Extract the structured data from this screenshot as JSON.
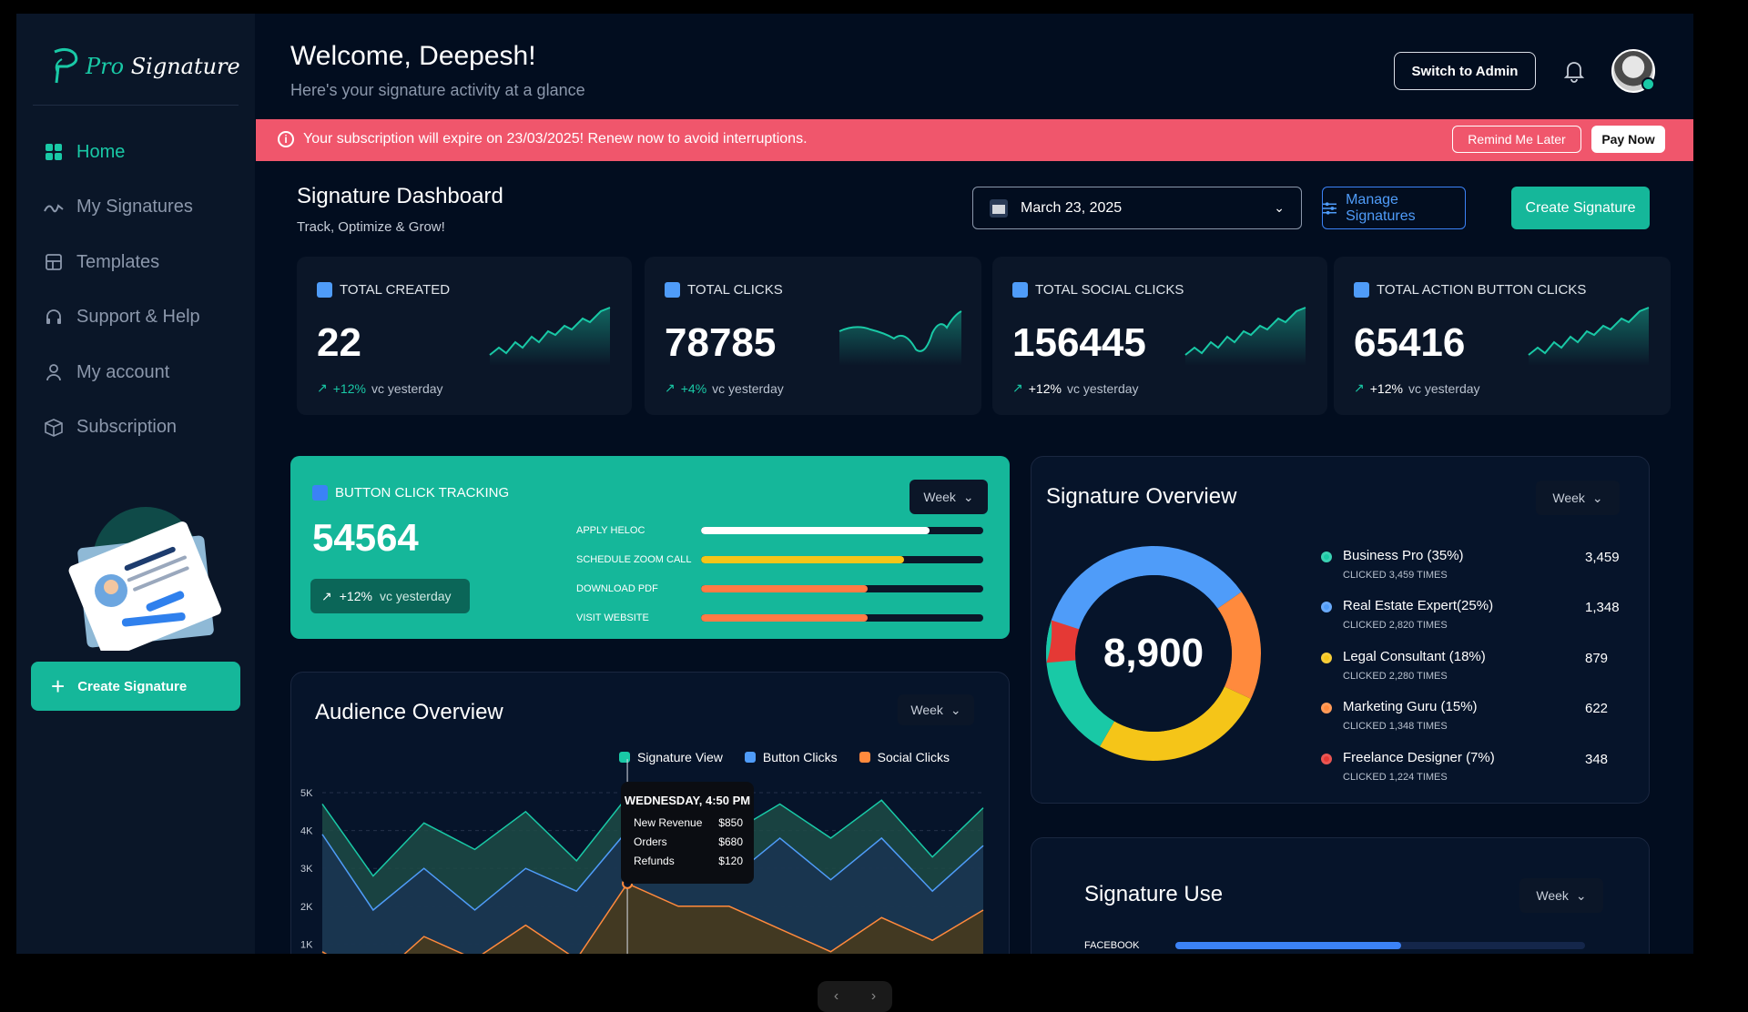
{
  "brand": {
    "logo_pro": "Pro",
    "logo_rest": "Signature"
  },
  "sidebar": {
    "items": [
      {
        "label": "Home",
        "icon": "grid-icon"
      },
      {
        "label": "My Signatures",
        "icon": "signature-icon"
      },
      {
        "label": "Templates",
        "icon": "templates-icon"
      },
      {
        "label": "Support & Help",
        "icon": "headset-icon"
      },
      {
        "label": "My account",
        "icon": "user-icon"
      },
      {
        "label": "Subscription",
        "icon": "box-icon"
      }
    ],
    "create_label": "Create Signature"
  },
  "header": {
    "title": "Welcome, Deepesh!",
    "subtitle": "Here's your signature activity at a glance",
    "admin_button": "Switch to Admin"
  },
  "banner": {
    "message": "Your subscription will expire on 23/03/2025! Renew now to avoid interruptions.",
    "remind_label": "Remind Me Later",
    "pay_label": "Pay Now"
  },
  "dashboard": {
    "title": "Signature Dashboard",
    "subtitle": "Track, Optimize & Grow!",
    "date": "March 23, 2025",
    "manage_label": "Manage Signatures",
    "create_label": "Create Signature"
  },
  "stats": [
    {
      "label": "TOTAL CREATED",
      "value": "22",
      "pct": "+12%",
      "suffix": "vc yesterday"
    },
    {
      "label": "TOTAL CLICKS",
      "value": "78785",
      "pct": "+4%",
      "suffix": "vc yesterday"
    },
    {
      "label": "TOTAL SOCIAL CLICKS",
      "value": "156445",
      "pct": "+12%",
      "suffix": "vc yesterday"
    },
    {
      "label": "TOTAL ACTION BUTTON CLICKS",
      "value": "65416",
      "pct": "+12%",
      "suffix": "vc yesterday"
    }
  ],
  "button_tracking": {
    "label": "BUTTON CLICK TRACKING",
    "value": "54564",
    "pct": "+12%",
    "suffix": "vc yesterday",
    "period": "Week",
    "bars": [
      {
        "name": "APPLY HELOC",
        "fraction": 0.81,
        "color": "#ffffff"
      },
      {
        "name": "SCHEDULE ZOOM CALL",
        "fraction": 0.72,
        "color": "#f5c518"
      },
      {
        "name": "DOWNLOAD PDF",
        "fraction": 0.59,
        "color": "#ff7a45"
      },
      {
        "name": "VISIT WEBSITE",
        "fraction": 0.59,
        "color": "#ff7a45"
      }
    ]
  },
  "overview": {
    "title": "Signature Overview",
    "period": "Week",
    "total": "8,900",
    "items": [
      {
        "name": "Business Pro (35%)",
        "clicked": "CLICKED 3,459 TIMES",
        "count": "3,459",
        "color": "#19c9a6"
      },
      {
        "name": "Real Estate Expert(25%)",
        "clicked": "CLICKED 2,820 TIMES",
        "count": "1,348",
        "color": "#4f9cf9"
      },
      {
        "name": "Legal Consultant (18%)",
        "clicked": "CLICKED 2,280 TIMES",
        "count": "879",
        "color": "#f5c518"
      },
      {
        "name": "Marketing Guru (15%)",
        "clicked": "CLICKED 1,348 TIMES",
        "count": "622",
        "color": "#ff8a3d"
      },
      {
        "name": "Freelance Designer (7%)",
        "clicked": "CLICKED 1,224 TIMES",
        "count": "348",
        "color": "#e53935"
      }
    ]
  },
  "audience": {
    "title": "Audience Overview",
    "period": "Week",
    "legend": [
      {
        "name": "Signature View",
        "color": "#19c9a6"
      },
      {
        "name": "Button Clicks",
        "color": "#4f9cf9"
      },
      {
        "name": "Social Clicks",
        "color": "#ff8a3d"
      }
    ],
    "y_ticks": [
      "5K",
      "4K",
      "3K",
      "2K",
      "1K"
    ],
    "tooltip": {
      "title": "WEDNESDAY, 4:50 PM",
      "rows": [
        {
          "label": "New Revenue",
          "value": "$850"
        },
        {
          "label": "Orders",
          "value": "$680"
        },
        {
          "label": "Refunds",
          "value": "$120"
        }
      ]
    }
  },
  "chart_data": {
    "type": "area",
    "ylim": [
      0,
      5000
    ],
    "series": [
      {
        "name": "Signature View",
        "values": [
          4700,
          2800,
          4200,
          3500,
          4500,
          3200,
          4900,
          4000,
          3900,
          4700,
          3800,
          4800,
          3300,
          4600
        ]
      },
      {
        "name": "Button Clicks",
        "values": [
          3900,
          1900,
          3000,
          1900,
          3000,
          2400,
          4000,
          3300,
          2700,
          3800,
          2700,
          3800,
          2400,
          3600
        ]
      },
      {
        "name": "Social Clicks",
        "values": [
          800,
          0,
          1200,
          600,
          1500,
          600,
          2600,
          2000,
          2000,
          1400,
          800,
          1700,
          1100,
          1900
        ]
      }
    ]
  },
  "signature_use": {
    "title": "Signature Use",
    "period": "Week",
    "rows": [
      {
        "name": "FACEBOOK",
        "fraction": 0.55
      }
    ]
  }
}
